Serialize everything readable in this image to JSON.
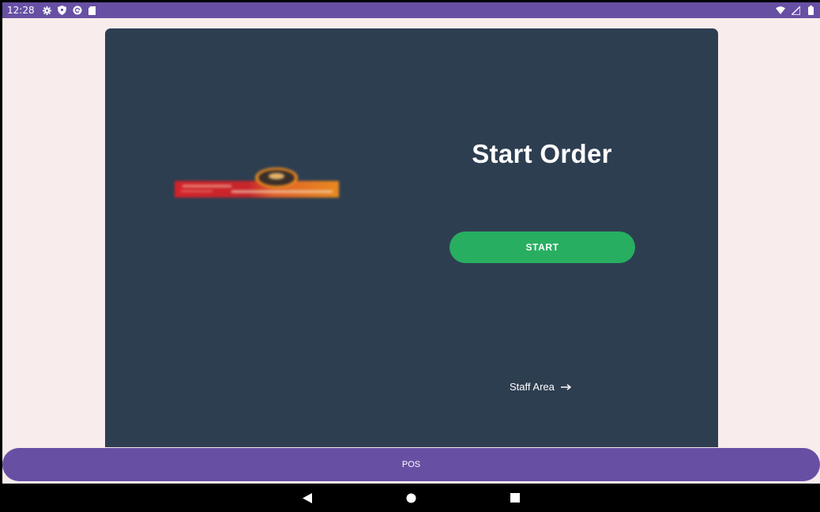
{
  "status_bar": {
    "time": "12:28",
    "left_icons": [
      "settings-icon",
      "shield-icon",
      "at-sign-icon",
      "sd-card-icon"
    ],
    "right_icons": [
      "wifi-icon",
      "signal-icon",
      "battery-icon"
    ]
  },
  "card": {
    "title": "Start Order",
    "start_button_label": "START",
    "staff_area_label": "Staff Area"
  },
  "bottom_bar": {
    "label": "POS"
  },
  "colors": {
    "status_bar": "#6750a4",
    "background": "#f8ecec",
    "card": "#2e3e51",
    "start_button": "#27ae60",
    "bottom_bar": "#6750a4"
  }
}
